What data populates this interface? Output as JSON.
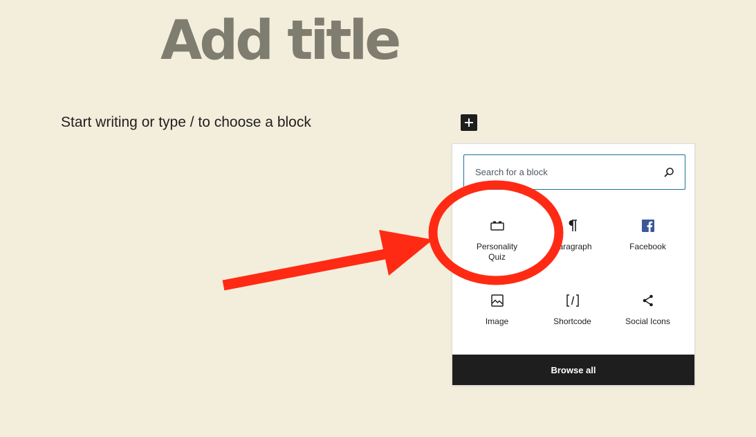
{
  "editor": {
    "title_placeholder": "Add title",
    "body_placeholder": "Start writing or type / to choose a block",
    "add_block_symbol": "+"
  },
  "inserter": {
    "search_placeholder": "Search for a block",
    "blocks": [
      {
        "label": "Personality Quiz",
        "icon": "quiz-block-icon"
      },
      {
        "label": "Paragraph",
        "icon": "pilcrow-icon"
      },
      {
        "label": "Facebook",
        "icon": "facebook-icon"
      },
      {
        "label": "Image",
        "icon": "image-icon"
      },
      {
        "label": "Shortcode",
        "icon": "shortcode-icon"
      },
      {
        "label": "Social Icons",
        "icon": "share-icon"
      }
    ],
    "browse_all_label": "Browse all"
  },
  "colors": {
    "background": "#f3eedb",
    "title": "#7f7c70",
    "accent": "#1d6fa0",
    "dark": "#1e1e1e",
    "facebook": "#3b5998",
    "annotation": "#ff2a14"
  }
}
